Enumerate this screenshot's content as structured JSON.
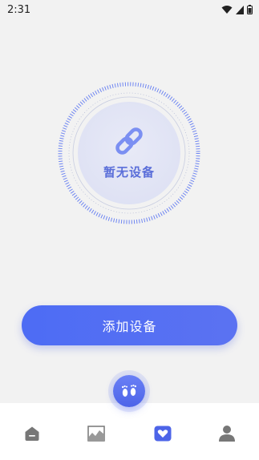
{
  "status_bar": {
    "time": "2:31",
    "icons": [
      "wifi-icon",
      "signal-icon",
      "battery-icon"
    ]
  },
  "device": {
    "empty_text": "暂无设备",
    "icon": "link-icon"
  },
  "actions": {
    "add_device_label": "添加设备"
  },
  "fab": {
    "icon": "footprints-icon"
  },
  "tab_bar": {
    "tabs": [
      {
        "icon": "home-icon",
        "active": false
      },
      {
        "icon": "chart-icon",
        "active": false
      },
      {
        "icon": "device-heart-icon",
        "active": true
      },
      {
        "icon": "profile-icon",
        "active": false
      }
    ]
  },
  "colors": {
    "accent": "#5068f0",
    "accent_text": "#5a6ed9",
    "background": "#f2f2f2",
    "inactive_icon": "#777777"
  }
}
